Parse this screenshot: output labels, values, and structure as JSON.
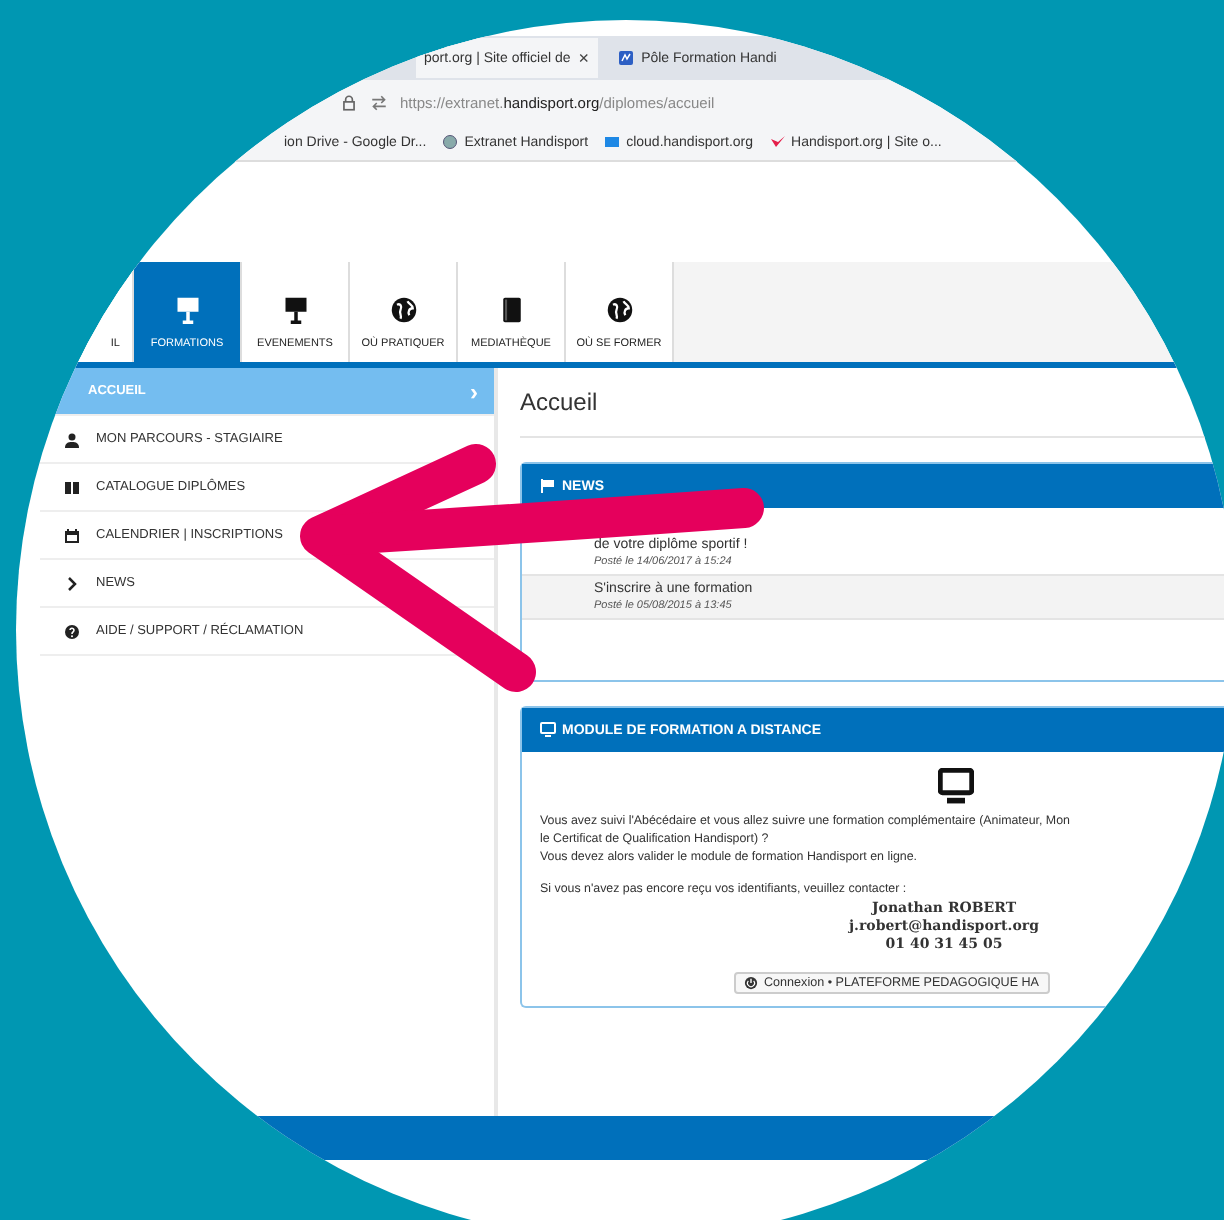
{
  "browser": {
    "tabs": [
      {
        "title": "port.org | Site officiel de",
        "close": "×",
        "selected": true
      },
      {
        "title": "Pôle Formation Handi",
        "selected": false
      }
    ],
    "address": {
      "host_prefix": "https://extranet.",
      "host": "handisport.org",
      "path": "/diplomes/accueil"
    },
    "bookmarks": [
      {
        "label": "ion Drive - Google Dr..."
      },
      {
        "label": "Extranet Handisport"
      },
      {
        "label": "cloud.handisport.org"
      },
      {
        "label": "Handisport.org | Site o..."
      }
    ]
  },
  "nav": [
    {
      "label": "IL",
      "selected": false
    },
    {
      "label": "FORMATIONS",
      "selected": true
    },
    {
      "label": "EVENEMENTS",
      "selected": false
    },
    {
      "label": "OÙ PRATIQUER",
      "selected": false
    },
    {
      "label": "MEDIATHÈQUE",
      "selected": false
    },
    {
      "label": "OÙ SE FORMER",
      "selected": false
    }
  ],
  "sidebar": {
    "items": [
      {
        "label": "ACCUEIL",
        "selected": true,
        "chevron": "›"
      },
      {
        "label": "MON PARCOURS - STAGIAIRE",
        "selected": false
      },
      {
        "label": "CATALOGUE DIPLÔMES",
        "selected": false
      },
      {
        "label": "CALENDRIER | INSCRIPTIONS",
        "selected": false
      },
      {
        "label": "NEWS",
        "selected": false
      },
      {
        "label": "AIDE / SUPPORT / RÉCLAMATION",
        "selected": false
      }
    ]
  },
  "main": {
    "heading": "Accueil",
    "news": {
      "title": "NEWS",
      "items": [
        {
          "title": "de votre diplôme sportif !",
          "posted": "Posté le 14/06/2017 à 15:24"
        },
        {
          "title": "S'inscrire à une formation",
          "posted": "Posté le 05/08/2015 à 13:45"
        }
      ]
    },
    "module": {
      "title": "MODULE DE FORMATION A DISTANCE",
      "lines": [
        "Vous avez suivi l'Abécédaire et vous allez suivre une formation complémentaire (Animateur, Mon",
        "le Certificat de Qualification Handisport) ?",
        "Vous devez alors valider le module de formation Handisport en ligne."
      ],
      "contact_intro": "Si vous n'avez pas encore reçu vos identifiants, veuillez contacter :",
      "contact": [
        "Jonathan ROBERT",
        "j.robert@handisport.org",
        "01 40 31 45 05"
      ],
      "button": "Connexion • PLATEFORME PEDAGOGIQUE HA"
    }
  }
}
